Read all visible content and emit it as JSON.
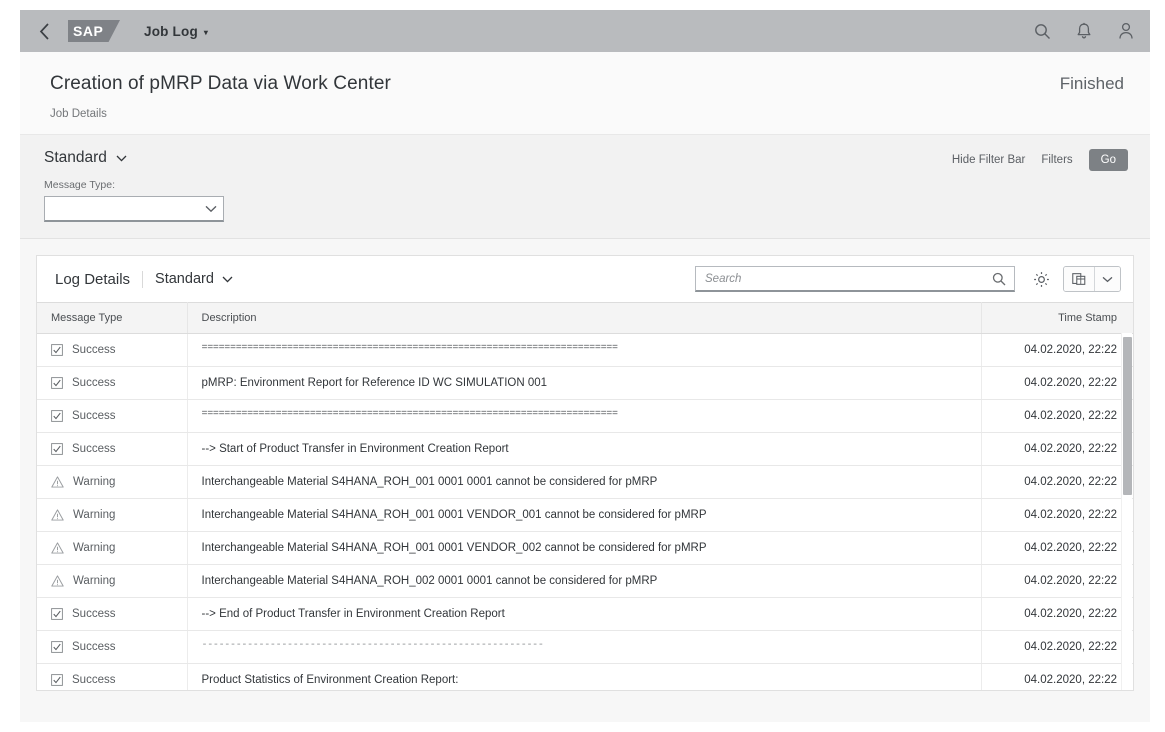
{
  "shell": {
    "back_icon": "chevron-left-icon",
    "logo_text": "SAP",
    "app_title": "Job Log",
    "app_title_caret": "▾",
    "icons": [
      "search-icon",
      "bell-icon",
      "user-avatar-icon"
    ]
  },
  "header": {
    "title": "Creation of pMRP Data via Work Center",
    "subtitle": "Job Details",
    "status": "Finished"
  },
  "filter_bar": {
    "variant": "Standard",
    "message_type_label": "Message Type:",
    "message_type_value": "",
    "hide_filter_bar": "Hide Filter Bar",
    "filters": "Filters",
    "go": "Go"
  },
  "table_toolbar": {
    "title": "Log Details",
    "variant": "Standard",
    "search_placeholder": "Search",
    "search_value": "",
    "settings_icon": "gear-icon",
    "export_icon": "spreadsheet-export-icon",
    "export_menu_icon": "chevron-down-icon"
  },
  "table": {
    "columns": [
      "Message Type",
      "Description",
      "Time Stamp"
    ],
    "rows": [
      {
        "type": "Success",
        "icon": "checkbox-checked-icon",
        "description": "=========================================================================",
        "timestamp": "04.02.2020, 22:22"
      },
      {
        "type": "Success",
        "icon": "checkbox-checked-icon",
        "description": "pMRP: Environment Report for Reference ID WC SIMULATION 001",
        "timestamp": "04.02.2020, 22:22"
      },
      {
        "type": "Success",
        "icon": "checkbox-checked-icon",
        "description": "=========================================================================",
        "timestamp": "04.02.2020, 22:22"
      },
      {
        "type": "Success",
        "icon": "checkbox-checked-icon",
        "description": "--> Start of Product Transfer in Environment Creation Report",
        "timestamp": "04.02.2020, 22:22"
      },
      {
        "type": "Warning",
        "icon": "warning-triangle-icon",
        "description": "Interchangeable Material S4HANA_ROH_001 0001 0001 cannot be considered for pMRP",
        "timestamp": "04.02.2020, 22:22"
      },
      {
        "type": "Warning",
        "icon": "warning-triangle-icon",
        "description": "Interchangeable Material S4HANA_ROH_001 0001 VENDOR_001 cannot be considered for pMRP",
        "timestamp": "04.02.2020, 22:22"
      },
      {
        "type": "Warning",
        "icon": "warning-triangle-icon",
        "description": "Interchangeable Material S4HANA_ROH_001 0001 VENDOR_002 cannot be considered for pMRP",
        "timestamp": "04.02.2020, 22:22"
      },
      {
        "type": "Warning",
        "icon": "warning-triangle-icon",
        "description": "Interchangeable Material S4HANA_ROH_002 0001 0001 cannot be considered for pMRP",
        "timestamp": "04.02.2020, 22:22"
      },
      {
        "type": "Success",
        "icon": "checkbox-checked-icon",
        "description": "--> End of Product Transfer in Environment Creation Report",
        "timestamp": "04.02.2020, 22:22"
      },
      {
        "type": "Success",
        "icon": "checkbox-checked-icon",
        "description": "------------------------------------------------------------",
        "timestamp": "04.02.2020, 22:22"
      },
      {
        "type": "Success",
        "icon": "checkbox-checked-icon",
        "description": "Product Statistics of Environment Creation Report:",
        "timestamp": "04.02.2020, 22:22"
      }
    ]
  },
  "colors": {
    "shellbar_bg": "#b9bbbe",
    "go_button_bg": "#7d8185",
    "text_primary": "#32363a",
    "text_secondary": "#6a6d70"
  }
}
